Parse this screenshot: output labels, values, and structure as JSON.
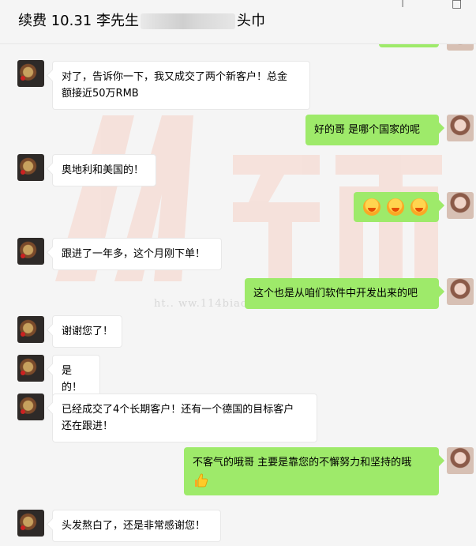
{
  "header": {
    "title_left": "续费 10.31 李先生",
    "title_right": "头巾",
    "pin_icon": "pin-icon",
    "close_icon": "close-icon"
  },
  "watermark": {
    "url": "ht.. ww.114biao.com"
  },
  "messages": [
    {
      "side": "left",
      "lines": [
        "对了，告诉你一下，我又成交了两个新客户！总金",
        "额接近50万RMB"
      ]
    },
    {
      "side": "right",
      "lines": [
        "好的哥  是哪个国家的呢"
      ]
    },
    {
      "side": "left",
      "lines": [
        "奥地利和美国的！"
      ]
    },
    {
      "side": "right",
      "emoji": "face-emoji",
      "count": 3
    },
    {
      "side": "left",
      "lines": [
        "跟进了一年多，这个月刚下单！"
      ]
    },
    {
      "side": "right",
      "lines": [
        "这个也是从咱们软件中开发出来的吧"
      ]
    },
    {
      "side": "left",
      "lines": [
        "谢谢您了！"
      ]
    },
    {
      "side": "left",
      "lines": [
        "是的！"
      ]
    },
    {
      "side": "left",
      "lines": [
        "已经成交了4个长期客户！还有一个德国的目标客户",
        "还在跟进！"
      ]
    },
    {
      "side": "right",
      "lines": [
        "不客气的哦哥  主要是靠您的不懈努力和坚持的哦"
      ],
      "emoji": "thumbs-up-emoji"
    },
    {
      "side": "left",
      "lines": [
        "头发熬白了，还是非常感谢您！"
      ]
    }
  ],
  "colors": {
    "right_bubble": "#9eea6a",
    "left_bubble": "#ffffff",
    "background": "#f5f5f5",
    "watermark": "#f6d2c6"
  }
}
